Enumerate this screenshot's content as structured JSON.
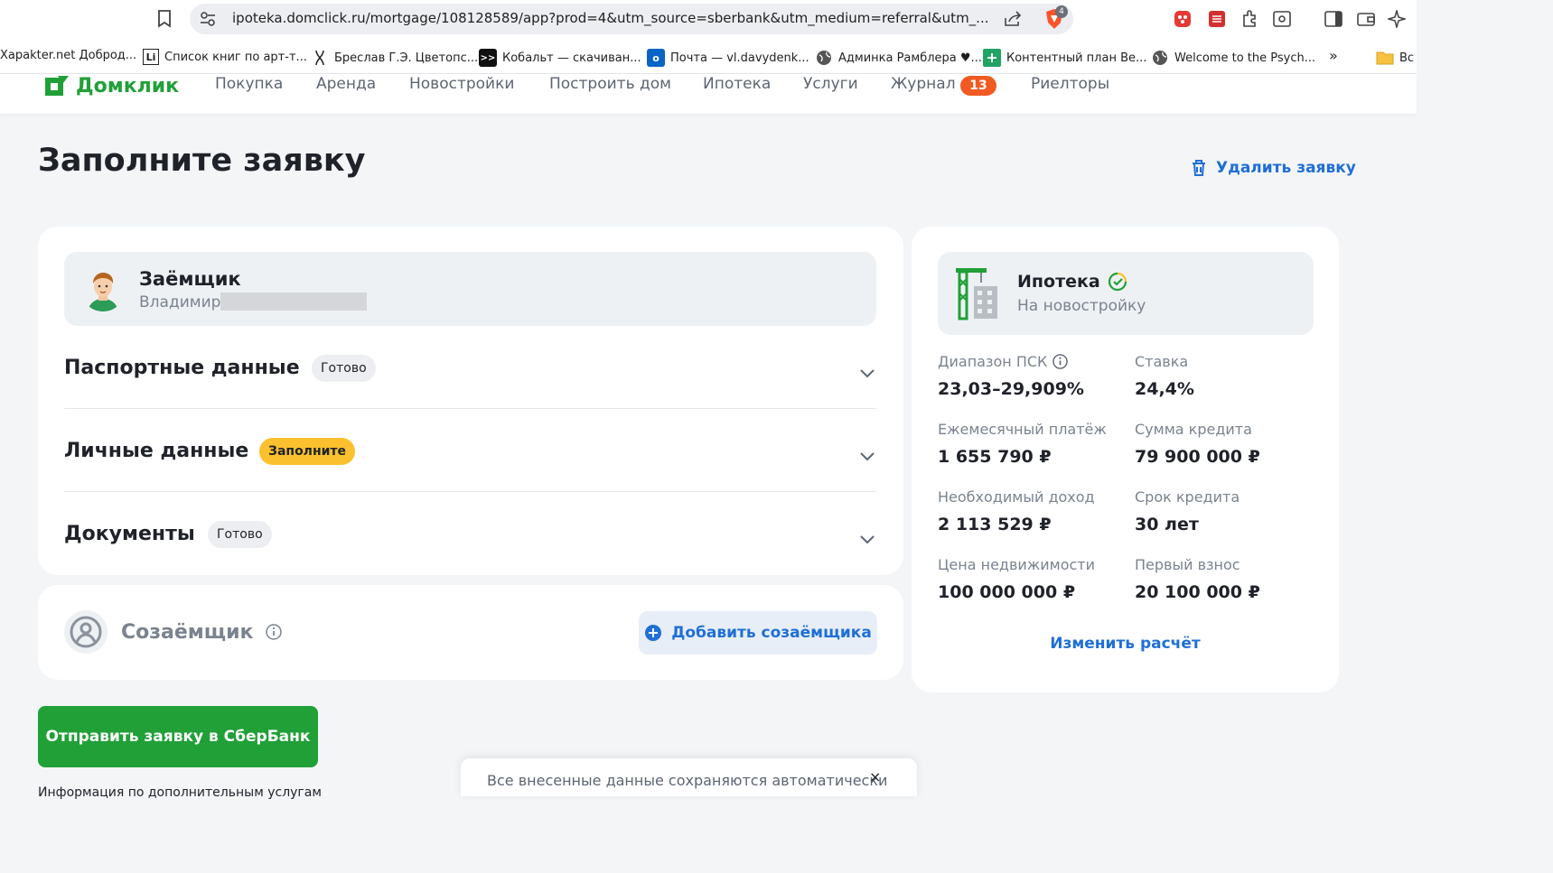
{
  "browser": {
    "url": "ipoteka.domclick.ru/mortgage/108128589/app?prod=4&utm_source=sberbank&utm_medium=referral&utm_...",
    "extension_badge": "4",
    "bookmarks": [
      {
        "label": "Xapakter.net Доброд...",
        "icon": "globe-icon"
      },
      {
        "label": "Список книг по арт-т...",
        "icon": "li-icon"
      },
      {
        "label": "Бреслав Г.Э. Цветопс...",
        "icon": "dna-icon"
      },
      {
        "label": "Кобальт — скачиван...",
        "icon": "terminal-icon"
      },
      {
        "label": "Почта — vl.davydenk...",
        "icon": "outlook-icon"
      },
      {
        "label": "Админка Рамблера ♥...",
        "icon": "globe-icon"
      },
      {
        "label": "Контентный план Ве...",
        "icon": "sheets-icon"
      },
      {
        "label": "Welcome to the Psych...",
        "icon": "globe-icon"
      }
    ],
    "more_bookmarks": "»",
    "folder_label": "Вс"
  },
  "site": {
    "logo": "Домклик",
    "nav": [
      "Покупка",
      "Аренда",
      "Новостройки",
      "Построить дом",
      "Ипотека",
      "Услуги",
      "Журнал",
      "Риелторы"
    ],
    "journal_badge": "13",
    "brand_green": "#21a038",
    "accent_blue": "#1f6fd6"
  },
  "page": {
    "title": "Заполните заявку",
    "delete_label": "Удалить заявку"
  },
  "borrower": {
    "title": "Заёмщик",
    "first_name": "Владимир"
  },
  "sections": [
    {
      "title": "Паспортные данные",
      "status": "Готово",
      "status_kind": "done"
    },
    {
      "title": "Личные данные",
      "status": "Заполните",
      "status_kind": "todo"
    },
    {
      "title": "Документы",
      "status": "Готово",
      "status_kind": "done"
    }
  ],
  "coborrower": {
    "title": "Созаёмщик",
    "add_label": "Добавить созаёмщика"
  },
  "submit_label": "Отправить заявку в СберБанк",
  "info_text": "Информация по дополнительным услугам",
  "mortgage": {
    "title": "Ипотека",
    "subtitle": "На новостройку",
    "stats": [
      {
        "label": "Диапазон ПСК",
        "value": "23,03–29,909%",
        "has_info": true
      },
      {
        "label": "Ставка",
        "value": "24,4%"
      },
      {
        "label": "Ежемесячный платёж",
        "value": "1 655 790 ₽"
      },
      {
        "label": "Сумма кредита",
        "value": "79 900 000 ₽"
      },
      {
        "label": "Необходимый доход",
        "value": "2 113 529 ₽"
      },
      {
        "label": "Срок кредита",
        "value": "30 лет"
      },
      {
        "label": "Цена недвижимости",
        "value": "100 000 000 ₽"
      },
      {
        "label": "Первый взнос",
        "value": "20 100 000 ₽"
      }
    ],
    "recalc_label": "Изменить расчёт"
  },
  "toast": {
    "text": "Все внесенные данные сохраняются автоматически",
    "close": "×"
  }
}
